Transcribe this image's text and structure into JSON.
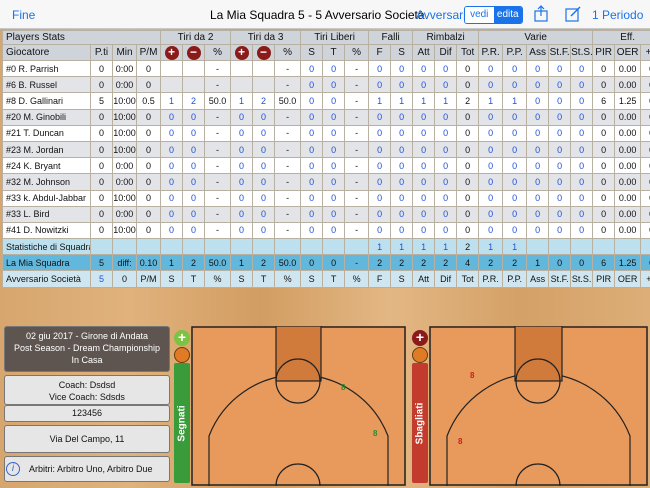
{
  "nav": {
    "done_label": "Fine",
    "title": "La Mia Squadra 5 - 5 Avversario Società",
    "opponent_label": "Avversari",
    "seg_view": "vedi",
    "seg_edit": "edita",
    "period_label": "1 Periodo"
  },
  "table": {
    "groups": {
      "players_stats": "Players Stats",
      "tiri2": "Tiri da 2",
      "tiri3": "Tiri da 3",
      "tiri_liberi": "Tiri Liberi",
      "falli": "Falli",
      "rimbalzi": "Rimbalzi",
      "varie": "Varie",
      "eff": "Eff."
    },
    "headers": [
      "Giocatore",
      "P.ti",
      "Min",
      "P/M",
      "+",
      "−",
      "%",
      "+",
      "−",
      "%",
      "S",
      "T",
      "%",
      "F",
      "S",
      "Att",
      "Dif",
      "Tot",
      "P.R.",
      "P.P.",
      "Ass",
      "St.F.",
      "St.S.",
      "PIR",
      "OER",
      "+/-"
    ],
    "rows": [
      {
        "name": "#0 R. Parrish",
        "v": [
          "0",
          "0:00",
          "0",
          "",
          "",
          "-",
          "",
          "",
          "-",
          "0",
          "0",
          "-",
          "0",
          "0",
          "0",
          "0",
          "0",
          "0",
          "0",
          "0",
          "0",
          "0",
          "0",
          "0.00",
          "0"
        ]
      },
      {
        "name": "#6 B. Russel",
        "v": [
          "0",
          "0:00",
          "0",
          "",
          "",
          "-",
          "",
          "",
          "-",
          "0",
          "0",
          "-",
          "0",
          "0",
          "0",
          "0",
          "0",
          "0",
          "0",
          "0",
          "0",
          "0",
          "0",
          "0.00",
          "0"
        ]
      },
      {
        "name": "#8 D. Gallinari",
        "v": [
          "5",
          "10:00",
          "0.5",
          "1",
          "2",
          "50.0",
          "1",
          "2",
          "50.0",
          "0",
          "0",
          "-",
          "1",
          "1",
          "1",
          "1",
          "2",
          "1",
          "1",
          "0",
          "0",
          "0",
          "6",
          "1.25",
          "0"
        ]
      },
      {
        "name": "#20 M. Ginobili",
        "v": [
          "0",
          "10:00",
          "0",
          "0",
          "0",
          "-",
          "0",
          "0",
          "-",
          "0",
          "0",
          "-",
          "0",
          "0",
          "0",
          "0",
          "0",
          "0",
          "0",
          "0",
          "0",
          "0",
          "0",
          "0.00",
          "0"
        ]
      },
      {
        "name": "#21 T. Duncan",
        "v": [
          "0",
          "10:00",
          "0",
          "0",
          "0",
          "-",
          "0",
          "0",
          "-",
          "0",
          "0",
          "-",
          "0",
          "0",
          "0",
          "0",
          "0",
          "0",
          "0",
          "0",
          "0",
          "0",
          "0",
          "0.00",
          "0"
        ]
      },
      {
        "name": "#23 M. Jordan",
        "v": [
          "0",
          "10:00",
          "0",
          "0",
          "0",
          "-",
          "0",
          "0",
          "-",
          "0",
          "0",
          "-",
          "0",
          "0",
          "0",
          "0",
          "0",
          "0",
          "0",
          "0",
          "0",
          "0",
          "0",
          "0.00",
          "0"
        ]
      },
      {
        "name": "#24 K. Bryant",
        "v": [
          "0",
          "0:00",
          "0",
          "0",
          "0",
          "-",
          "0",
          "0",
          "-",
          "0",
          "0",
          "-",
          "0",
          "0",
          "0",
          "0",
          "0",
          "0",
          "0",
          "0",
          "0",
          "0",
          "0",
          "0.00",
          "0"
        ]
      },
      {
        "name": "#32 M. Johnson",
        "v": [
          "0",
          "0:00",
          "0",
          "0",
          "0",
          "-",
          "0",
          "0",
          "-",
          "0",
          "0",
          "-",
          "0",
          "0",
          "0",
          "0",
          "0",
          "0",
          "0",
          "0",
          "0",
          "0",
          "0",
          "0.00",
          "0"
        ]
      },
      {
        "name": "#33 k. Abdul-Jabbar",
        "v": [
          "0",
          "10:00",
          "0",
          "0",
          "0",
          "-",
          "0",
          "0",
          "-",
          "0",
          "0",
          "-",
          "0",
          "0",
          "0",
          "0",
          "0",
          "0",
          "0",
          "0",
          "0",
          "0",
          "0",
          "0.00",
          "0"
        ]
      },
      {
        "name": "#33 L. Bird",
        "v": [
          "0",
          "0:00",
          "0",
          "0",
          "0",
          "-",
          "0",
          "0",
          "-",
          "0",
          "0",
          "-",
          "0",
          "0",
          "0",
          "0",
          "0",
          "0",
          "0",
          "0",
          "0",
          "0",
          "0",
          "0.00",
          "0"
        ]
      },
      {
        "name": "#41 D. Nowitzki",
        "v": [
          "0",
          "10:00",
          "0",
          "0",
          "0",
          "-",
          "0",
          "0",
          "-",
          "0",
          "0",
          "-",
          "0",
          "0",
          "0",
          "0",
          "0",
          "0",
          "0",
          "0",
          "0",
          "0",
          "0",
          "0.00",
          "0"
        ]
      }
    ],
    "team_stats": {
      "label": "Statistiche di Squadra",
      "v": [
        "",
        "",
        "",
        "",
        "",
        "",
        "",
        "",
        "",
        "",
        "",
        "",
        "1",
        "1",
        "1",
        "1",
        "2",
        "1",
        "1",
        "",
        "",
        "",
        "",
        "",
        ""
      ]
    },
    "my_team": {
      "label": "La Mia Squadra",
      "v": [
        "5",
        "diff:",
        "0.10",
        "1",
        "2",
        "50.0",
        "1",
        "2",
        "50.0",
        "0",
        "0",
        "-",
        "2",
        "2",
        "2",
        "2",
        "4",
        "2",
        "2",
        "1",
        "0",
        "0",
        "6",
        "1.25",
        "0"
      ]
    },
    "opp_team": {
      "label": "Avversario Società",
      "v": [
        "5",
        "0",
        "P/M",
        "S",
        "T",
        "%",
        "S",
        "T",
        "%",
        "S",
        "T",
        "%",
        "F",
        "S",
        "Att",
        "Dif",
        "Tot",
        "P.R.",
        "P.P.",
        "Ass",
        "St.F.",
        "St.S.",
        "PIR",
        "OER",
        "+/-"
      ]
    }
  },
  "info": {
    "date_line": "02 giu 2017 - Girone di Andata",
    "event_line": "Post Season - Dream Championship",
    "venue_line": "In Casa",
    "coach": "Coach: Dsdsd",
    "vice_coach": "Vice Coach: Sdsds",
    "code": "123456",
    "address": "Via Del Campo, 11",
    "referees": "Arbitri: Arbitro Uno, Arbitro Due"
  },
  "shots": {
    "made_label": "Segnati",
    "missed_label": "Sbagliati",
    "made_marks": [
      "8",
      "8"
    ],
    "missed_marks": [
      "8",
      "8"
    ],
    "made_color": "#2e8b2e",
    "missed_color": "#c8201a"
  },
  "colors": {
    "accent": "#1a73e8",
    "court": "#e89a5c",
    "made_bar": "#3a9b3a",
    "missed_bar": "#c33b2c"
  }
}
